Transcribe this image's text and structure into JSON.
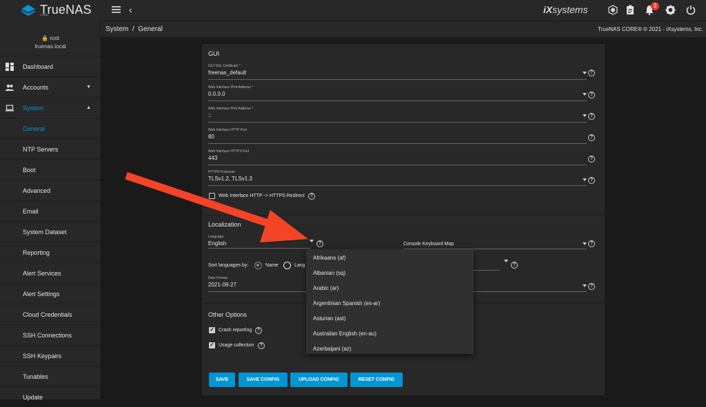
{
  "topbar": {
    "brand": "TrueNAS",
    "brand_sub": "CORE",
    "ix_brand_1": "iX",
    "ix_brand_2": "systems",
    "alert_count": "3"
  },
  "breadcrumb": {
    "root": "System",
    "separator": "/",
    "current": "General"
  },
  "copyright": "TrueNAS CORE® © 2021 - iXsystems, Inc.",
  "sidebar": {
    "user": "root",
    "host": "truenas.local",
    "items": [
      {
        "label": "Dashboard",
        "icon": "dashboard-icon"
      },
      {
        "label": "Accounts",
        "icon": "people-icon"
      },
      {
        "label": "System",
        "icon": "laptop-icon"
      },
      {
        "label": "General"
      },
      {
        "label": "NTP Servers"
      },
      {
        "label": "Boot"
      },
      {
        "label": "Advanced"
      },
      {
        "label": "Email"
      },
      {
        "label": "System Dataset"
      },
      {
        "label": "Reporting"
      },
      {
        "label": "Alert Services"
      },
      {
        "label": "Alert Settings"
      },
      {
        "label": "Cloud Credentials"
      },
      {
        "label": "SSH Connections"
      },
      {
        "label": "SSH Keypairs"
      },
      {
        "label": "Tunables"
      },
      {
        "label": "Update"
      }
    ]
  },
  "gui": {
    "title": "GUI",
    "ssl_cert": {
      "label": "GUI SSL Certificate *",
      "value": "freenas_default"
    },
    "ipv4": {
      "label": "Web Interface IPv4 Address *",
      "value": "0.0.0.0"
    },
    "ipv6": {
      "label": "Web Interface IPv6 Address *",
      "value": "::"
    },
    "http_port": {
      "label": "Web Interface HTTP Port",
      "value": "80"
    },
    "https_port": {
      "label": "Web Interface HTTPS Port",
      "value": "443"
    },
    "https_protocols": {
      "label": "HTTPS Protocols",
      "value": "TLSv1.2, TLSv1.3"
    },
    "redirect_label": "Web Interface HTTP -> HTTPS Redirect"
  },
  "localization": {
    "title": "Localization",
    "language": {
      "label": "Language",
      "value": "English"
    },
    "keyboard_map": {
      "label": "Console Keyboard Map"
    },
    "sort_by_label": "Sort languages by:",
    "sort_name": "Name",
    "sort_lang": "Lang",
    "date_format": {
      "label": "Date Format",
      "value": "2021-09-27"
    }
  },
  "other": {
    "title": "Other Options",
    "crash_reporting": "Crash reporting",
    "usage_collection": "Usage collection"
  },
  "buttons": {
    "save": "SAVE",
    "save_config": "SAVE CONFIG",
    "upload_config": "UPLOAD CONFIG",
    "reset_config": "RESET CONFIG"
  },
  "language_options": [
    "Afrikaans (af)",
    "Albanian (sq)",
    "Arabic (ar)",
    "Argentinian Spanish (es-ar)",
    "Asturian (ast)",
    "Australian English (en-au)",
    "Azerbaijani (az)"
  ],
  "colors": {
    "accent": "#0095d5",
    "arrow": "#f44326",
    "badge": "#e53935"
  }
}
